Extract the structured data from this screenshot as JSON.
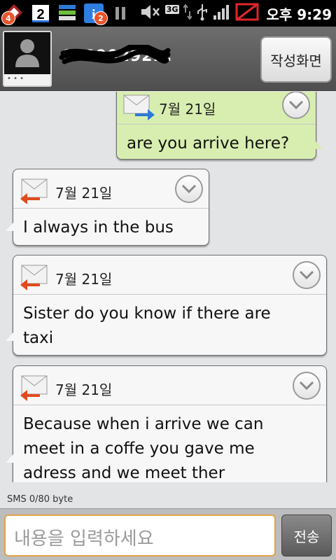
{
  "status_bar": {
    "notification_badges": [
      "4",
      "2"
    ],
    "network": "3G",
    "time": "오후 9:29"
  },
  "header": {
    "contact_name": "01090292...",
    "compose_label": "작성화면",
    "avatar_caption": "• • •"
  },
  "messages": [
    {
      "direction": "outgoing",
      "date": "7월 21일",
      "text": "are you arrive here?"
    },
    {
      "direction": "incoming",
      "date": "7월 21일",
      "text": "I always in the bus"
    },
    {
      "direction": "incoming",
      "date": "7월 21일",
      "text": "Sister do you know if there are taxi"
    },
    {
      "direction": "incoming",
      "date": "7월 21일",
      "text": "Because when i arrive we can meet in a coffe you gave me adress and we meet ther"
    }
  ],
  "composer": {
    "counter": "SMS  0/80 byte",
    "placeholder": "내용을 입력하세요",
    "send_label": "전송"
  },
  "colors": {
    "outgoing_bubble": "#d8eeb0",
    "incoming_bubble": "#f7f7f7",
    "input_border": "#e0a24a"
  }
}
